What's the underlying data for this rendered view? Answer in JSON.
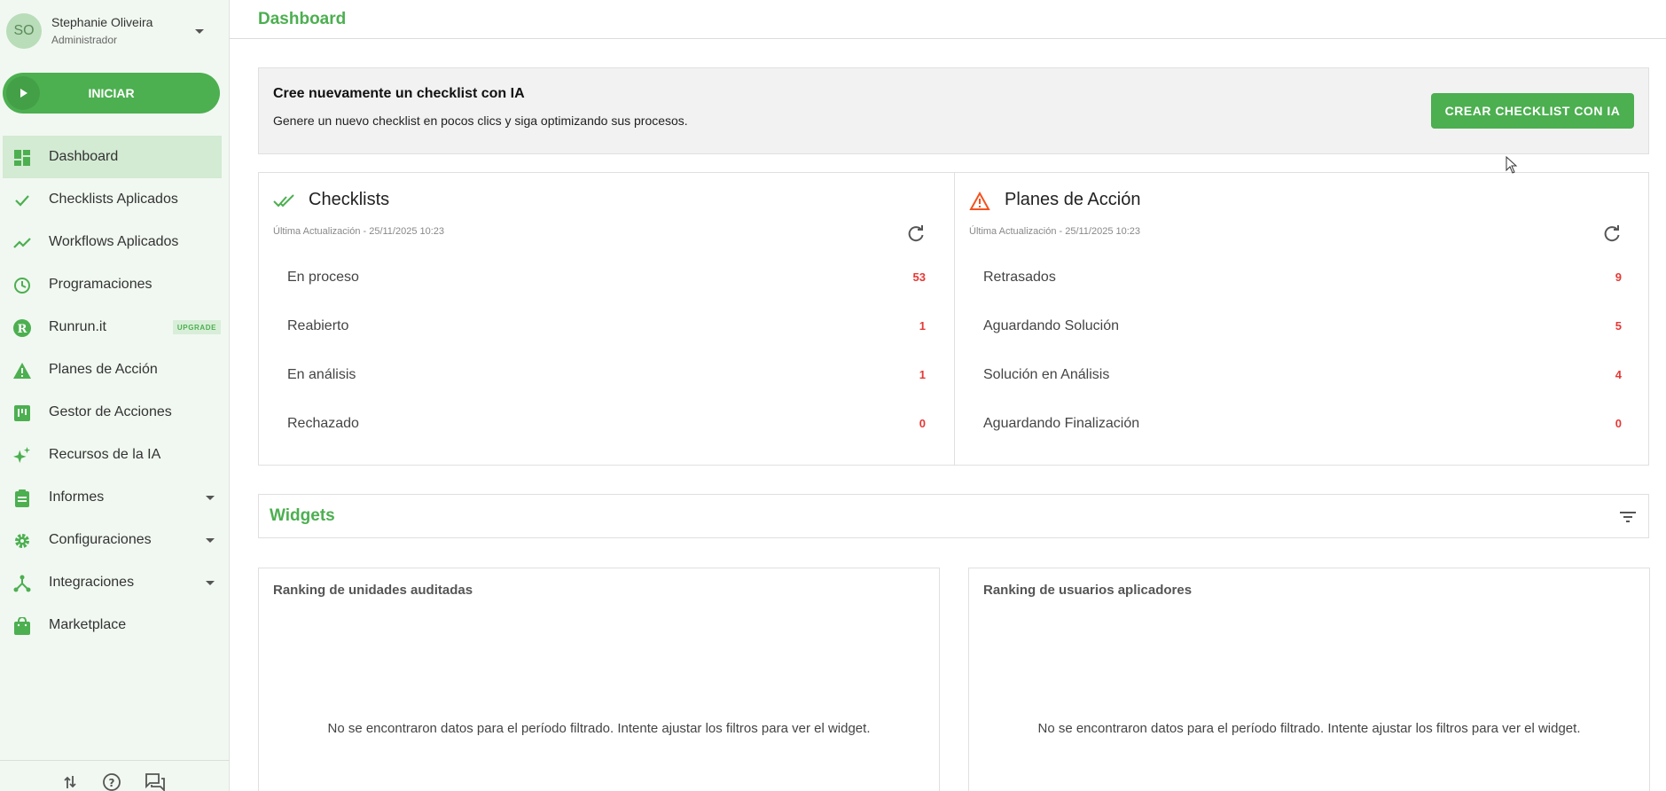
{
  "user": {
    "initials": "SO",
    "name": "Stephanie Oliveira",
    "role": "Administrador"
  },
  "start_button": {
    "label": "INICIAR"
  },
  "nav": [
    {
      "label": "Dashboard",
      "icon": "dashboard-icon",
      "active": true
    },
    {
      "label": "Checklists Aplicados",
      "icon": "check-icon"
    },
    {
      "label": "Workflows Aplicados",
      "icon": "trend-icon"
    },
    {
      "label": "Programaciones",
      "icon": "clock-icon"
    },
    {
      "label": "Runrun.it",
      "icon": "runrun-icon",
      "badge": "UPGRADE"
    },
    {
      "label": "Planes de Acción",
      "icon": "warning-icon"
    },
    {
      "label": "Gestor de Acciones",
      "icon": "kanban-icon"
    },
    {
      "label": "Recursos de la IA",
      "icon": "sparkle-icon"
    },
    {
      "label": "Informes",
      "icon": "clipboard-icon",
      "expandable": true
    },
    {
      "label": "Configuraciones",
      "icon": "gear-icon",
      "expandable": true
    },
    {
      "label": "Integraciones",
      "icon": "hub-icon",
      "expandable": true
    },
    {
      "label": "Marketplace",
      "icon": "bag-icon"
    }
  ],
  "footer_icons": [
    "sort-icon",
    "help-icon",
    "chat-icon"
  ],
  "header": {
    "title": "Dashboard"
  },
  "banner": {
    "title": "Cree nuevamente un checklist con IA",
    "subtitle": "Genere un nuevo checklist en pocos clics y siga optimizando sus procesos.",
    "button": "CREAR CHECKLIST CON IA"
  },
  "checklists": {
    "title": "Checklists",
    "updated": "Última Actualización - 25/11/2025 10:23",
    "rows": [
      {
        "label": "En proceso",
        "value": "53"
      },
      {
        "label": "Reabierto",
        "value": "1"
      },
      {
        "label": "En análisis",
        "value": "1"
      },
      {
        "label": "Rechazado",
        "value": "0"
      }
    ]
  },
  "action_plans": {
    "title": "Planes de Acción",
    "updated": "Última Actualización - 25/11/2025 10:23",
    "rows": [
      {
        "label": "Retrasados",
        "value": "9"
      },
      {
        "label": "Aguardando Solución",
        "value": "5"
      },
      {
        "label": "Solución en Análisis",
        "value": "4"
      },
      {
        "label": "Aguardando Finalización",
        "value": "0"
      }
    ]
  },
  "widgets": {
    "title": "Widgets",
    "cards": [
      {
        "title": "Ranking de unidades auditadas",
        "empty": "No se encontraron datos para el período filtrado. Intente ajustar los filtros para ver el widget."
      },
      {
        "title": "Ranking de usuarios aplicadores",
        "empty": "No se encontraron datos para el período filtrado. Intente ajustar los filtros para ver el widget."
      }
    ]
  },
  "colors": {
    "accent": "#4caf50",
    "alert": "#e53935",
    "warning": "#f4511e",
    "sidebar_bg": "#f1f8f1"
  }
}
